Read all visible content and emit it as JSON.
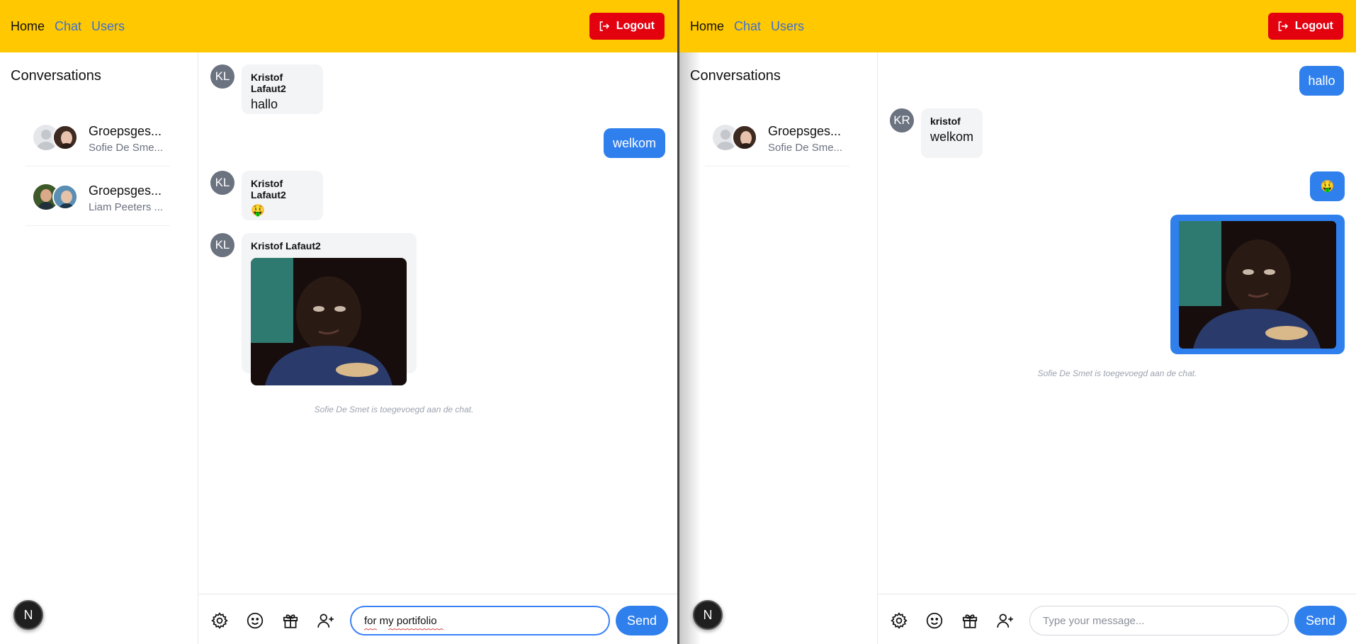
{
  "left": {
    "nav": {
      "home": "Home",
      "chat": "Chat",
      "users": "Users",
      "logout": "Logout"
    },
    "sidebar": {
      "title": "Conversations",
      "conversations": [
        {
          "title": "Groepsges...",
          "subtitle": "Sofie De Sme..."
        },
        {
          "title": "Groepsges...",
          "subtitle": "Liam Peeters ..."
        }
      ]
    },
    "messages": [
      {
        "initials": "KL",
        "author": "Kristof Lafaut2",
        "text": "hallo"
      },
      {
        "text": "welkom"
      },
      {
        "initials": "KL",
        "author": "Kristof Lafaut2",
        "text": "🤑"
      },
      {
        "initials": "KL",
        "author": "Kristof Lafaut2"
      }
    ],
    "system_message": "Sofie De Smet is toegevoegd aan de chat.",
    "composer": {
      "value": "for my portifolio",
      "send": "Send"
    },
    "floating_badge": "N"
  },
  "right": {
    "nav": {
      "home": "Home",
      "chat": "Chat",
      "users": "Users",
      "logout": "Logout"
    },
    "sidebar": {
      "title": "Conversations",
      "conversations": [
        {
          "title": "Groepsges...",
          "subtitle": "Sofie De Sme..."
        }
      ]
    },
    "messages": [
      {
        "text": "hallo"
      },
      {
        "initials": "KR",
        "author": "kristof",
        "text": "welkom"
      },
      {
        "text": "🤑"
      }
    ],
    "system_message": "Sofie De Smet is toegevoegd aan de chat.",
    "composer": {
      "placeholder": "Type your message...",
      "send": "Send"
    },
    "floating_badge": "N"
  },
  "colors": {
    "navbar": "#ffc800",
    "logout": "#e3000f",
    "accent": "#2f80ed",
    "link": "#3b6fd6"
  },
  "icons": [
    "logout-icon",
    "settings-icon",
    "emoji-icon",
    "gift-icon",
    "add-user-icon"
  ]
}
